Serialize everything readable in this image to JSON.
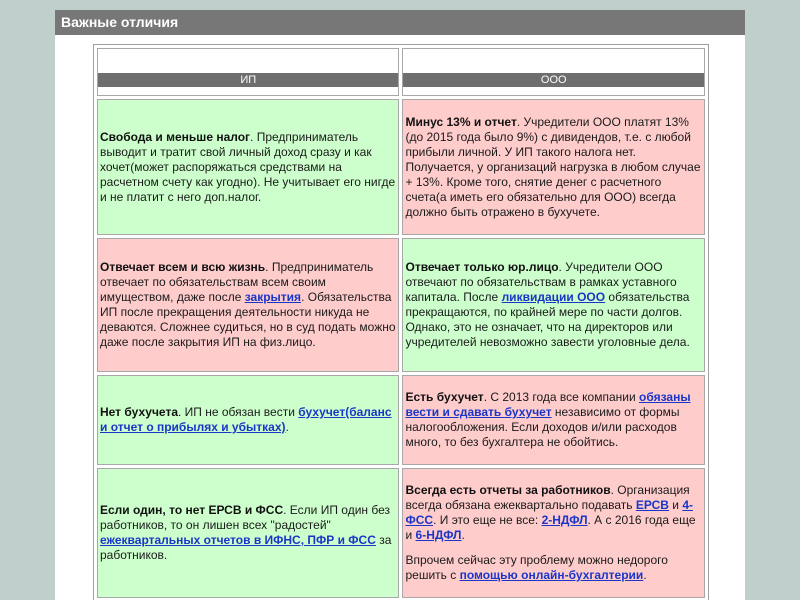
{
  "title": "Важные отличия",
  "columns": {
    "ip": "ИП",
    "ooo": "ООО"
  },
  "rows": [
    {
      "ip": {
        "bold": "Свобода и меньше налог",
        "text": ". Предприниматель выводит и тратит свой личный доход сразу и как хочет(может распоряжаться средствами на расчетном счету как угодно). Не учитывает его нигде и не платит с него доп.налог."
      },
      "ooo": {
        "bold": "Минус 13% и отчет",
        "text": ". Учредители ООО платят 13%(до 2015 года было 9%) с дивидендов, т.е. с любой прибыли личной. У ИП такого налога нет. Получается, у организаций нагрузка в любом случае + 13%. Кроме того, снятие денег с расчетного счета(а иметь его обязательно для ООО) всегда должно быть отражено в бухучете."
      }
    },
    {
      "ip": {
        "bold": "Отвечает всем и всю жизнь",
        "text1": ". Предприниматель отвечает по обязательствам всем своим имуществом, даже после ",
        "link": "закрытия",
        "text2": ". Обязательства ИП после прекращения деятельности никуда не деваются. Сложнее судиться, но в суд подать можно даже после закрытия ИП на физ.лицо."
      },
      "ooo": {
        "bold": "Отвечает только юр.лицо",
        "text1": ". Учредители ООО отвечают по обязательствам в рамках уставного капитала. После ",
        "link": "ликвидации ООО",
        "text2": " обязательства прекращаются, по крайней мере по части долгов. Однако, это не означает, что на директоров или учредителей невозможно завести уголовные дела."
      }
    },
    {
      "ip": {
        "bold": "Нет бухучета",
        "text1": ". ИП не обязан вести ",
        "link": "бухучет(баланс и отчет о прибылях и убытках)",
        "text2": "."
      },
      "ooo": {
        "bold": "Есть бухучет",
        "text1": ". С 2013 года все компании ",
        "link": "обязаны вести и сдавать бухучет",
        "text2": " независимо от формы налогообложения. Если доходов и/или расходов много, то без бухгалтера не обойтись."
      }
    },
    {
      "ip": {
        "bold": "Если один, то нет ЕРСВ и ФСС",
        "text1": ". Если ИП один без работников, то он лишен всех \"радостей\" ",
        "link": "ежеквартальных отчетов в ИФНС, ПФР и ФСС",
        "text2": " за работников."
      },
      "ooo": {
        "bold": "Всегда есть отчеты за работников",
        "text1": ". Организация всегда обязана ежеквартально подавать ",
        "link1": "ЕРСВ",
        "text2": " и ",
        "link2": "4-ФСС",
        "text3": ". И это еще не все: ",
        "link3": "2-НДФЛ",
        "text4": ". А с 2016 года еще и ",
        "link4": "6-НДФЛ",
        "text5": ".",
        "text6": "Впрочем сейчас эту проблему можно недорого решить с ",
        "link5": "помощью онлайн-бухгалтерии",
        "text7": "."
      }
    }
  ],
  "colors": {
    "green": "#ccffcc",
    "pink": "#ffcccc",
    "header": "#777777",
    "link": "#1a36c8",
    "background": "#bfd0cc"
  }
}
